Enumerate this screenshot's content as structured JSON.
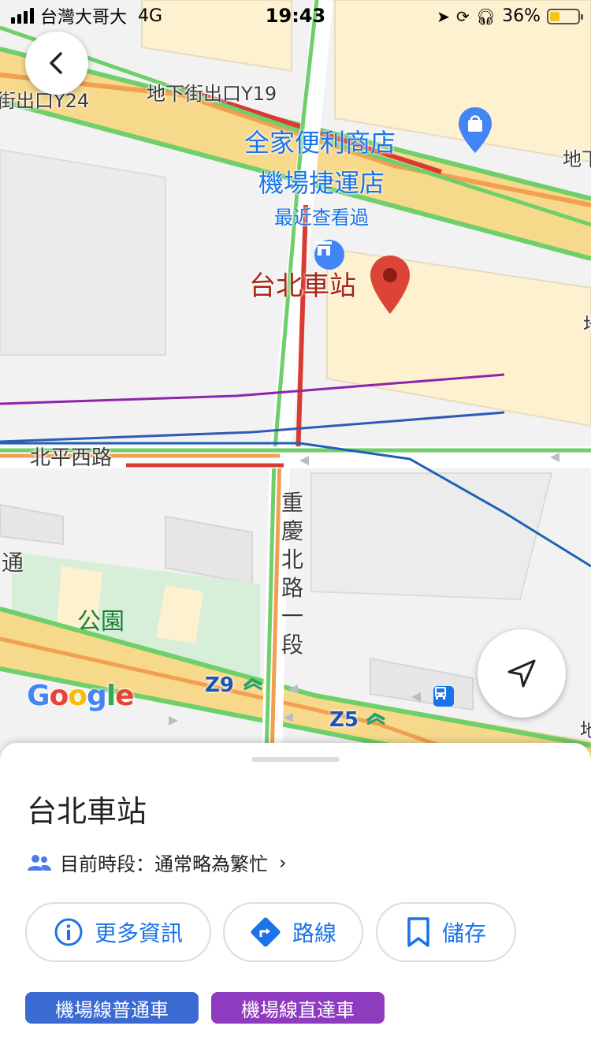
{
  "status_bar": {
    "carrier": "台灣大哥大",
    "network": "4G",
    "time": "19:43",
    "battery_percent": "36%",
    "battery_level": 0.36
  },
  "map": {
    "labels": {
      "exit_y24": "街出口Y24",
      "exit_y19": "地下街出口Y19",
      "poi_store_line1": "全家便利商店",
      "poi_store_line2": "機場捷運店",
      "recently_viewed": "最近查看過",
      "selected_place": "台北車站",
      "road_beiping": "北平西路",
      "road_chongqing": "重慶北路一段",
      "park": "公園",
      "edge_tong": "通",
      "edge_dixia": "地下",
      "edge_di": "地",
      "station_z9": "Z9",
      "station_z5": "Z5",
      "google_logo": "Google"
    },
    "colors": {
      "traffic_green": "#6fcf6a",
      "traffic_orange": "#f29f52",
      "traffic_red": "#d93b32",
      "highway": "#f7d98b",
      "building": "#fdf1d0",
      "metro_purple": "#8e24aa",
      "metro_blue": "#2f5bb7",
      "metro_blue2": "#1f62b5"
    }
  },
  "sheet": {
    "title": "台北車站",
    "busyness": "目前時段：通常略為繁忙",
    "buttons": {
      "more_info": "更多資訊",
      "directions": "路線",
      "save": "儲存"
    },
    "chips": [
      {
        "label": "機場線普通車",
        "color": "#3c6ad3"
      },
      {
        "label": "機場線直達車",
        "color": "#8e3bbf"
      }
    ]
  }
}
